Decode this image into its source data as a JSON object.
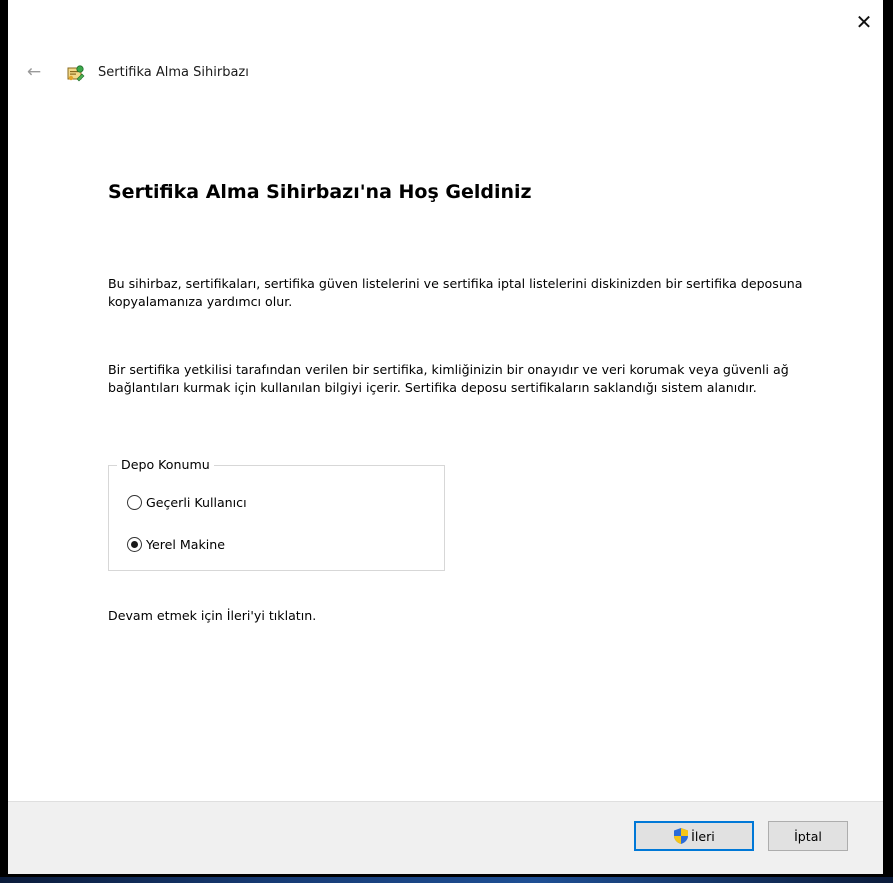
{
  "window": {
    "title": "Sertifika Alma Sihirbazı",
    "close_glyph": "✕",
    "back_glyph": "←"
  },
  "content": {
    "heading": "Sertifika Alma Sihirbazı'na Hoş Geldiniz",
    "paragraph1": "Bu sihirbaz, sertifikaları, sertifika güven listelerini ve sertifika iptal listelerini diskinizden bir sertifika deposuna kopyalamanıza yardımcı olur.",
    "paragraph2": "Bir sertifika yetkilisi tarafından verilen bir sertifika, kimliğinizin bir onayıdır ve veri korumak veya güvenli ağ bağlantıları kurmak için kullanılan bilgiyi içerir. Sertifika deposu sertifikaların saklandığı sistem alanıdır.",
    "store_location": {
      "legend": "Depo Konumu",
      "options": [
        {
          "label": "Geçerli Kullanıcı",
          "checked": false
        },
        {
          "label": "Yerel Makine",
          "checked": true
        }
      ]
    },
    "continue_text": "Devam etmek için İleri'yi tıklatın."
  },
  "footer": {
    "next_label": "İleri",
    "cancel_label": "İptal"
  },
  "colors": {
    "accent": "#0078d7",
    "footer_bg": "#f0f0f0",
    "outer_bg": "#000000"
  },
  "icons": {
    "wizard": "certificate-wizard-icon",
    "uac": "uac-shield-icon"
  }
}
